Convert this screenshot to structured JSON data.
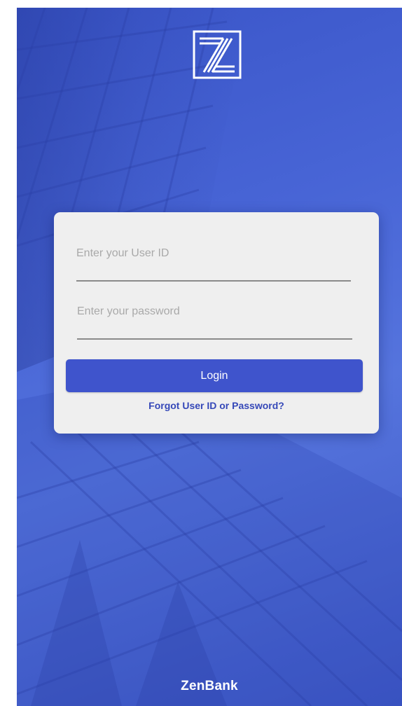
{
  "app": {
    "brand_name": "ZenBank",
    "logo_icon": "zenbank-logo-icon"
  },
  "login_form": {
    "user_id": {
      "value": "",
      "placeholder": "Enter your User ID"
    },
    "password": {
      "value": "",
      "placeholder": "Enter your password"
    },
    "login_label": "Login",
    "forgot_label": "Forgot User ID or Password?"
  },
  "colors": {
    "background_blue": "#4865d6",
    "button_blue": "#3f54cc",
    "link_blue": "#3548b8",
    "card_background": "#efefef"
  }
}
